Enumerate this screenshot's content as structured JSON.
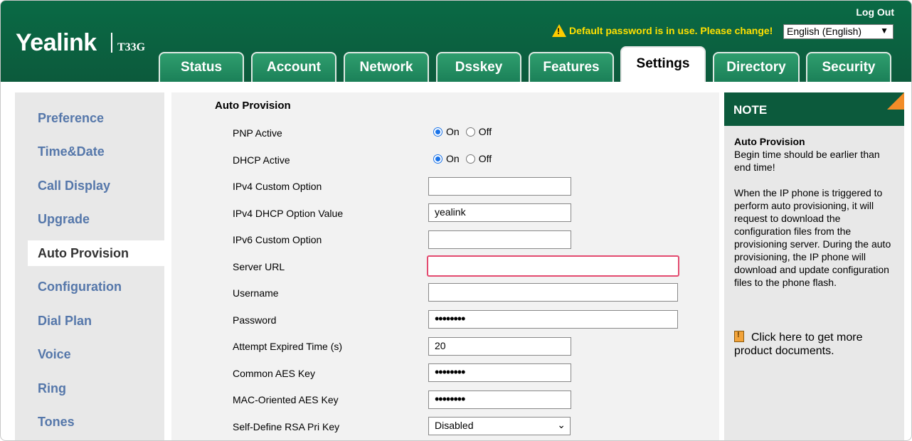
{
  "header": {
    "logo": "Yealink",
    "model": "T33G",
    "logout": "Log Out",
    "warning": "Default password is in use. Please change!",
    "language": "English (English)"
  },
  "tabs": [
    {
      "label": "Status"
    },
    {
      "label": "Account"
    },
    {
      "label": "Network"
    },
    {
      "label": "Dsskey"
    },
    {
      "label": "Features"
    },
    {
      "label": "Settings"
    },
    {
      "label": "Directory"
    },
    {
      "label": "Security"
    }
  ],
  "active_tab": "Settings",
  "sidebar": {
    "items": [
      {
        "label": "Preference"
      },
      {
        "label": "Time&Date"
      },
      {
        "label": "Call Display"
      },
      {
        "label": "Upgrade"
      },
      {
        "label": "Auto Provision"
      },
      {
        "label": "Configuration"
      },
      {
        "label": "Dial Plan"
      },
      {
        "label": "Voice"
      },
      {
        "label": "Ring"
      },
      {
        "label": "Tones"
      }
    ],
    "active": "Auto Provision"
  },
  "form": {
    "title": "Auto Provision",
    "pnp_active": {
      "label": "PNP Active",
      "on": "On",
      "off": "Off",
      "value": "On"
    },
    "dhcp_active": {
      "label": "DHCP Active",
      "on": "On",
      "off": "Off",
      "value": "On"
    },
    "ipv4_custom_option": {
      "label": "IPv4 Custom Option",
      "value": ""
    },
    "ipv4_dhcp_option_value": {
      "label": "IPv4 DHCP Option Value",
      "value": "yealink"
    },
    "ipv6_custom_option": {
      "label": "IPv6 Custom Option",
      "value": ""
    },
    "server_url": {
      "label": "Server URL",
      "value": ""
    },
    "username": {
      "label": "Username",
      "value": ""
    },
    "password": {
      "label": "Password",
      "value": "••••••••"
    },
    "attempt_expired_time": {
      "label": "Attempt Expired Time (s)",
      "value": "20"
    },
    "common_aes_key": {
      "label": "Common AES Key",
      "value": "••••••••"
    },
    "mac_oriented_aes_key": {
      "label": "MAC-Oriented AES Key",
      "value": "••••••••"
    },
    "self_define_rsa_pri_key": {
      "label": "Self-Define RSA Pri Key",
      "value": "Disabled"
    }
  },
  "note": {
    "title": "NOTE",
    "heading": "Auto Provision",
    "line1": "Begin time should be earlier than end time!",
    "line2": "When the IP phone is triggered to perform auto provisioning, it will request to download the configuration files from the provisioning server. During the auto provisioning, the IP phone will download and update configuration files to the phone flash.",
    "link": "Click here to get more product documents."
  },
  "colors": {
    "header_green": "#0c5a3c",
    "tab_green": "#1b8058",
    "sidebar_link": "#5577aa",
    "warning_yellow": "#ffe000",
    "focus_border": "#e34a6f",
    "note_corner": "#f28c28"
  }
}
